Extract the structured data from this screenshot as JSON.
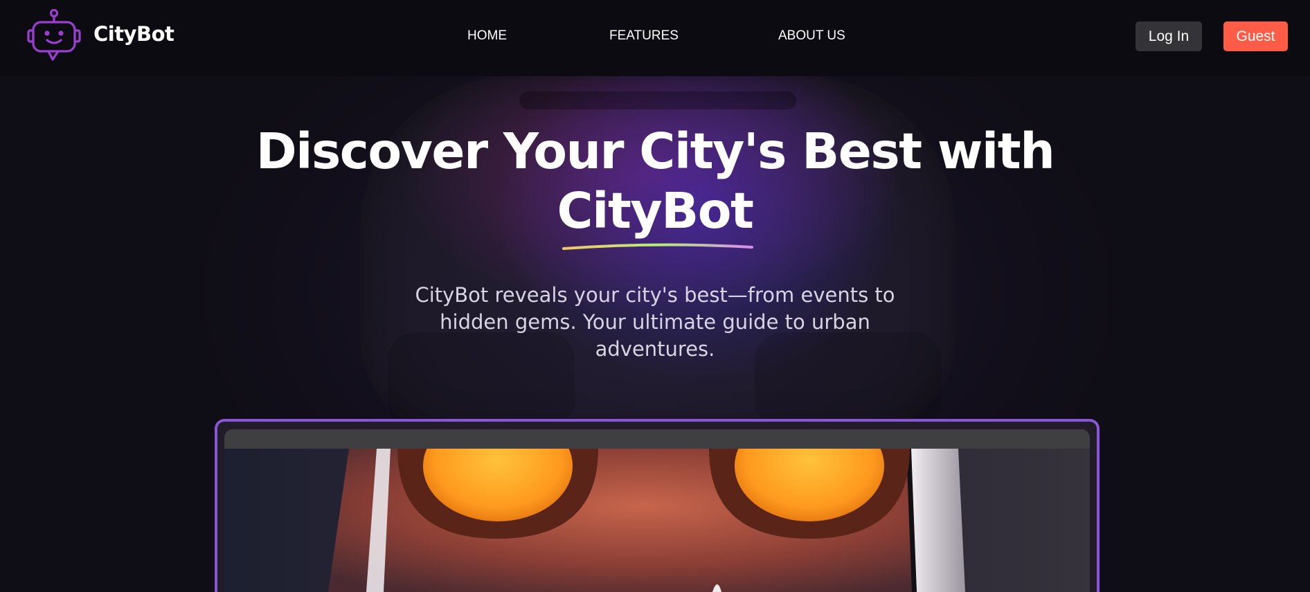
{
  "brand": {
    "name": "CityBot",
    "logo_icon": "robot-chat-icon",
    "accent": "#9b3fd0"
  },
  "nav": {
    "links": [
      {
        "label": "HOME"
      },
      {
        "label": "FEATURES"
      },
      {
        "label": "ABOUT US"
      }
    ],
    "login_label": "Log In",
    "guest_label": "Guest"
  },
  "hero": {
    "title_line1": "Discover Your City's Best with",
    "title_line2": "CityBot",
    "subtitle": "CityBot reveals your city's best—from events to hidden gems. Your ultimate guide to urban adventures.",
    "underline_colors": [
      "#f3c56b",
      "#b5f07a",
      "#d98af0"
    ]
  },
  "preview": {
    "frame_color": "#8a55d6",
    "image_icon": "robot-face-illustration"
  },
  "colors": {
    "guest_button": "#ff5c47",
    "login_button": "#343438"
  }
}
